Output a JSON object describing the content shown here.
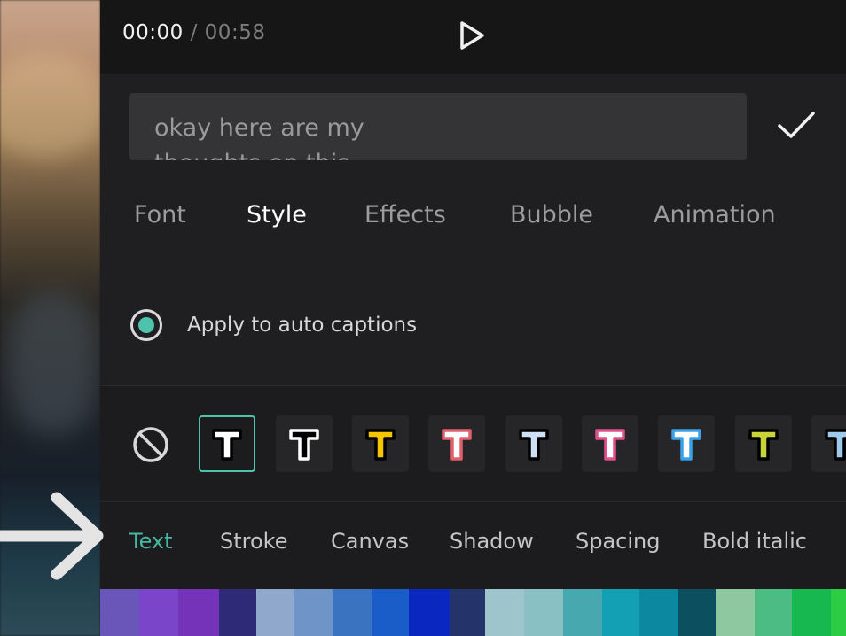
{
  "player": {
    "current_time": "00:00",
    "separator": "/",
    "total_time": "00:58"
  },
  "text_input": {
    "line1": "okay here are my",
    "line2": "thoughts on this"
  },
  "icons": {
    "play": "play-icon",
    "confirm": "checkmark-icon",
    "none": "no-style-icon",
    "arrow": "arrow-right-icon"
  },
  "tabs": [
    {
      "label": "Font",
      "active": false
    },
    {
      "label": "Style",
      "active": true
    },
    {
      "label": "Effects",
      "active": false
    },
    {
      "label": "Bubble",
      "active": false
    },
    {
      "label": "Animation",
      "active": false
    }
  ],
  "apply_auto_captions": {
    "label": "Apply to auto captions",
    "checked": true
  },
  "style_presets": [
    {
      "fill": "#ffffff",
      "stroke": "#000000",
      "selected": true
    },
    {
      "fill": "#000000",
      "stroke": "#ffffff",
      "selected": false
    },
    {
      "fill": "#f5c400",
      "stroke": "#000000",
      "selected": false
    },
    {
      "fill": "#ffffff",
      "stroke": "#e0606e",
      "selected": false
    },
    {
      "fill": "#cfe0f5",
      "stroke": "#000000",
      "selected": false
    },
    {
      "fill": "#ffffff",
      "stroke": "#e0508a",
      "selected": false
    },
    {
      "fill": "#ffffff",
      "stroke": "#3aa0e8",
      "selected": false
    },
    {
      "fill": "#c8d43a",
      "stroke": "#000000",
      "selected": false
    },
    {
      "fill": "#a0c8e8",
      "stroke": "#000000",
      "selected": false
    }
  ],
  "subtabs": [
    {
      "label": "Text",
      "active": true
    },
    {
      "label": "Stroke",
      "active": false
    },
    {
      "label": "Canvas",
      "active": false
    },
    {
      "label": "Shadow",
      "active": false
    },
    {
      "label": "Spacing",
      "active": false
    },
    {
      "label": "Bold italic",
      "active": false
    }
  ],
  "swatches": [
    "#6a55b8",
    "#7a45c8",
    "#7433b8",
    "#2e2a78",
    "#8fa8cc",
    "#6e94c8",
    "#3a74c0",
    "#1a5cc8",
    "#0a28c0",
    "#24346a",
    "#9ec4cc",
    "#88c0c4",
    "#48a8b0",
    "#14a0b4",
    "#0c88a0",
    "#0c5060",
    "#8ec8a0",
    "#4cbc84",
    "#18b850",
    "#2ccc44"
  ],
  "colors": {
    "accent": "#45b9a2",
    "panel_bg": "#1b1b1d"
  }
}
